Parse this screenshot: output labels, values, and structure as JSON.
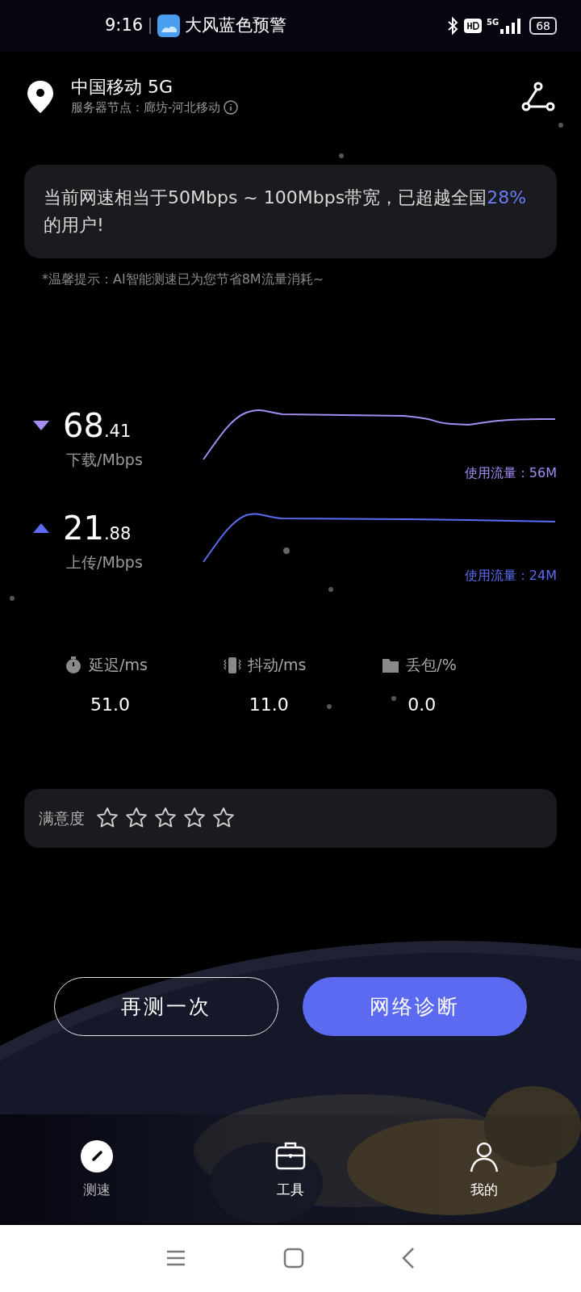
{
  "status_bar": {
    "time": "9:16",
    "notification": "大风蓝色预警",
    "network": "5G",
    "battery": "68"
  },
  "header": {
    "carrier": "中国移动 5G",
    "server": "服务器节点：廊坊-河北移动"
  },
  "summary": {
    "before": "当前网速相当于50Mbps ~ 100Mbps带宽，已超越全国",
    "highlight": "28%",
    "after": "的用户!"
  },
  "tip": "*温馨提示：AI智能测速已为您节省8M流量消耗~",
  "speeds": [
    {
      "kind": "download",
      "value": "68",
      "decimals": ".41",
      "unit": "下载/Mbps",
      "usage": "使用流量：56M",
      "color": "#a48cf2"
    },
    {
      "kind": "upload",
      "value": "21",
      "decimals": ".88",
      "unit": "上传/Mbps",
      "usage": "使用流量：24M",
      "color": "#5c6cf2"
    }
  ],
  "metrics": [
    {
      "kind": "latency",
      "label": "延迟/ms",
      "value": "51.0"
    },
    {
      "kind": "jitter",
      "label": "抖动/ms",
      "value": "11.0"
    },
    {
      "kind": "loss",
      "label": "丢包/%",
      "value": "0.0"
    }
  ],
  "rating": {
    "label": "满意度",
    "stars": 0
  },
  "buttons": [
    {
      "label": "再测一次",
      "kind": "outline"
    },
    {
      "label": "网络诊断",
      "kind": "primary"
    }
  ],
  "tabs": [
    {
      "label": "测速",
      "selected": true
    },
    {
      "label": "工具",
      "selected": false
    },
    {
      "label": "我的",
      "selected": false
    }
  ]
}
